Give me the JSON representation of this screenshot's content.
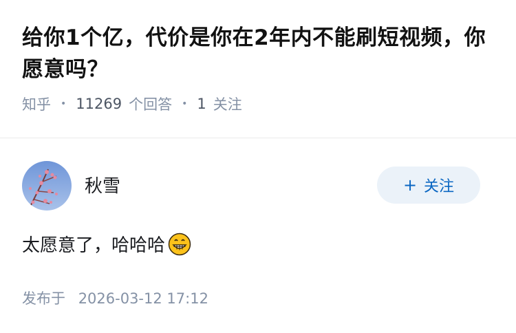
{
  "question": {
    "title": "给你1个亿，代价是你在2年内不能刷短视频，你愿意吗？",
    "source": "知乎",
    "answer_count": "11269",
    "answer_count_suffix": "个回答",
    "follow_count": "1",
    "follow_suffix": "关注"
  },
  "author": {
    "name": "秋雪",
    "follow_label": "关注",
    "follow_icon": "plus-icon"
  },
  "answer": {
    "text": "太愿意了，哈哈哈",
    "emoji": "grinning-face-icon"
  },
  "footer": {
    "published_label": "发布于",
    "published_time": "2026-03-12 17:12"
  },
  "colors": {
    "accent": "#0a66c2",
    "follow_bg": "#ebf2f9",
    "meta_text": "#8491a5"
  }
}
